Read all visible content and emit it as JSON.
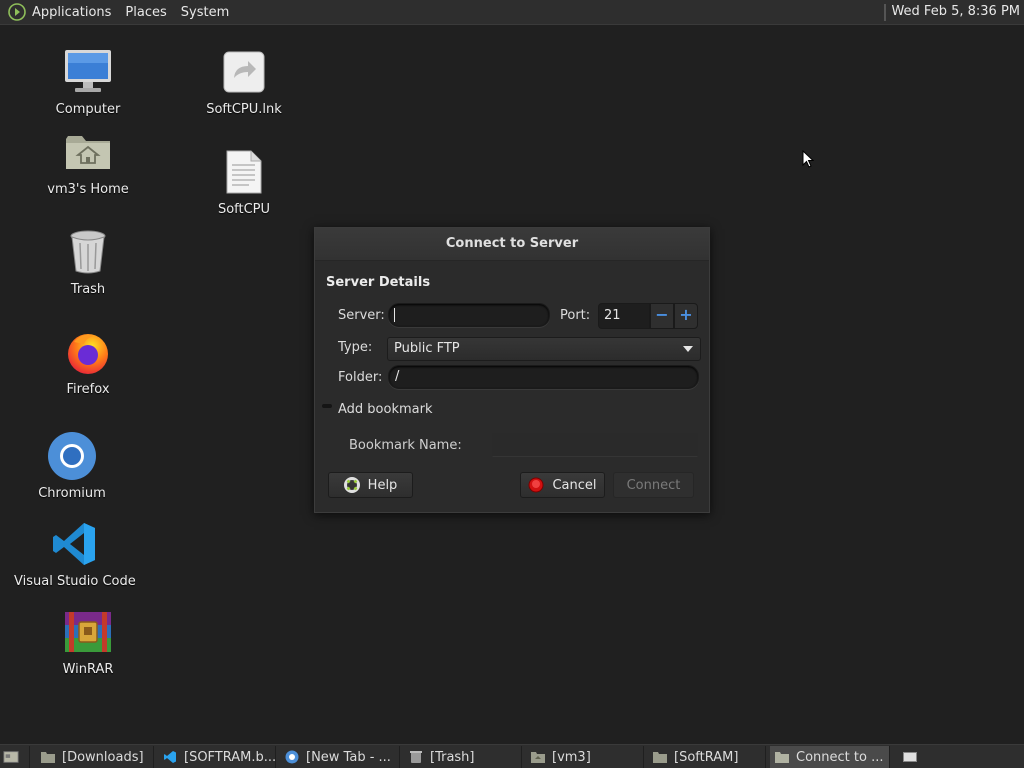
{
  "top_panel": {
    "menus": [
      "Applications",
      "Places",
      "System"
    ],
    "clock": "Wed Feb  5,  8:36 PM"
  },
  "desktop_icons": [
    {
      "label": "Computer",
      "icon": "computer-icon"
    },
    {
      "label": "vm3's Home",
      "icon": "home-folder-icon"
    },
    {
      "label": "Trash",
      "icon": "trash-icon"
    },
    {
      "label": "Firefox",
      "icon": "firefox-icon"
    },
    {
      "label": "Chromium",
      "icon": "chromium-icon"
    },
    {
      "label": "Visual Studio Code",
      "icon": "vscode-icon"
    },
    {
      "label": "WinRAR",
      "icon": "winrar-icon"
    },
    {
      "label": "SoftCPU.lnk",
      "icon": "link-file-icon"
    },
    {
      "label": "SoftCPU",
      "icon": "text-file-icon"
    }
  ],
  "dialog": {
    "title": "Connect to Server",
    "section": "Server Details",
    "server_label": "Server:",
    "server_value": "",
    "port_label": "Port:",
    "port_value": "21",
    "type_label": "Type:",
    "type_value": "Public FTP",
    "folder_label": "Folder:",
    "folder_value": "/",
    "add_bookmark_label": "Add bookmark",
    "add_bookmark_checked": false,
    "bookmark_name_label": "Bookmark Name:",
    "bookmark_name_value": "",
    "help_button": "Help",
    "cancel_button": "Cancel",
    "connect_button": "Connect"
  },
  "taskbar": {
    "tasks": [
      {
        "label": "[Downloads]",
        "icon": "folder-icon",
        "active": false
      },
      {
        "label": "[SOFTRAM.b...",
        "icon": "vscode-icon",
        "active": false
      },
      {
        "label": "[New Tab - ...",
        "icon": "chromium-icon",
        "active": false
      },
      {
        "label": "[Trash]",
        "icon": "trash-icon",
        "active": false
      },
      {
        "label": "[vm3]",
        "icon": "home-folder-icon",
        "active": false
      },
      {
        "label": "[SoftRAM]",
        "icon": "folder-icon",
        "active": false
      },
      {
        "label": "Connect to ...",
        "icon": "folder-icon",
        "active": true
      }
    ]
  },
  "colors": {
    "desktop_bg": "#202020",
    "panel_bg": "#2e2e2e",
    "accent_blue": "#4a90e2",
    "cancel_red": "#d01010"
  }
}
